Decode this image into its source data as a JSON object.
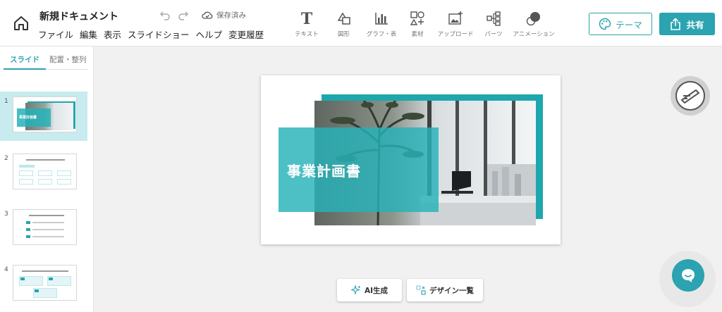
{
  "header": {
    "doc_title": "新規ドキュメント",
    "menu": [
      "ファイル",
      "編集",
      "表示",
      "スライドショー",
      "ヘルプ",
      "変更履歴"
    ],
    "save_status": "保存済み",
    "theme_label": "テーマ",
    "share_label": "共有"
  },
  "toolbar": {
    "items": [
      {
        "label": "テキスト",
        "icon": "text-icon"
      },
      {
        "label": "図形",
        "icon": "shape-icon"
      },
      {
        "label": "グラフ・表",
        "icon": "chart-icon"
      },
      {
        "label": "素材",
        "icon": "elements-icon"
      },
      {
        "label": "アップロード",
        "icon": "upload-image-icon"
      },
      {
        "label": "パーツ",
        "icon": "parts-icon"
      },
      {
        "label": "アニメーション",
        "icon": "animation-icon"
      }
    ]
  },
  "sidebar": {
    "tabs": [
      "スライド",
      "配置・整列"
    ],
    "slides": [
      {
        "number": "1",
        "title": "事業計画書"
      },
      {
        "number": "2",
        "title": ""
      },
      {
        "number": "3",
        "title": ""
      },
      {
        "number": "4",
        "title": ""
      }
    ]
  },
  "slide": {
    "title": "事業計画書"
  },
  "bottom_actions": {
    "ai_label": "AI生成",
    "design_label": "デザイン一覧"
  },
  "colors": {
    "accent": "#2ba3b0",
    "slide_teal": "#26b2b8",
    "frame_teal": "#1ea7ad"
  }
}
